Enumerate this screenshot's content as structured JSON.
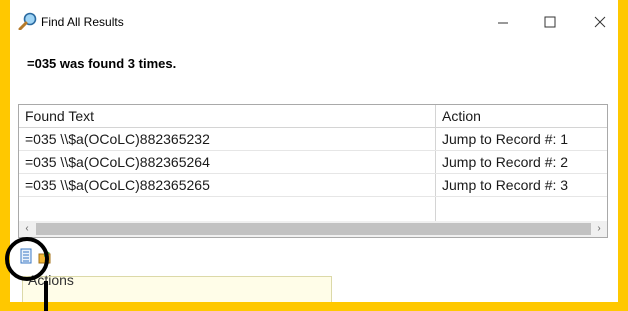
{
  "window": {
    "title": "Find All Results"
  },
  "message": "=035 was found 3 times.",
  "grid": {
    "columns": [
      "Found Text",
      "Action"
    ],
    "rows": [
      {
        "found_text": "=035  \\\\$a(OCoLC)882365232",
        "action": "Jump to Record #: 1"
      },
      {
        "found_text": "=035  \\\\$a(OCoLC)882365264",
        "action": "Jump to Record #: 2"
      },
      {
        "found_text": "=035  \\\\$a(OCoLC)882365265",
        "action": "Jump to Record #: 3"
      }
    ]
  },
  "actions_panel": {
    "label": "Actions"
  },
  "icons": {
    "title": "search-icon",
    "minimize": "minimize-icon",
    "maximize": "maximize-icon",
    "close": "close-icon",
    "toolbar": [
      "notepad-icon",
      "export-icon"
    ]
  },
  "colors": {
    "background": "#FFC800",
    "annotation": "#000000"
  }
}
